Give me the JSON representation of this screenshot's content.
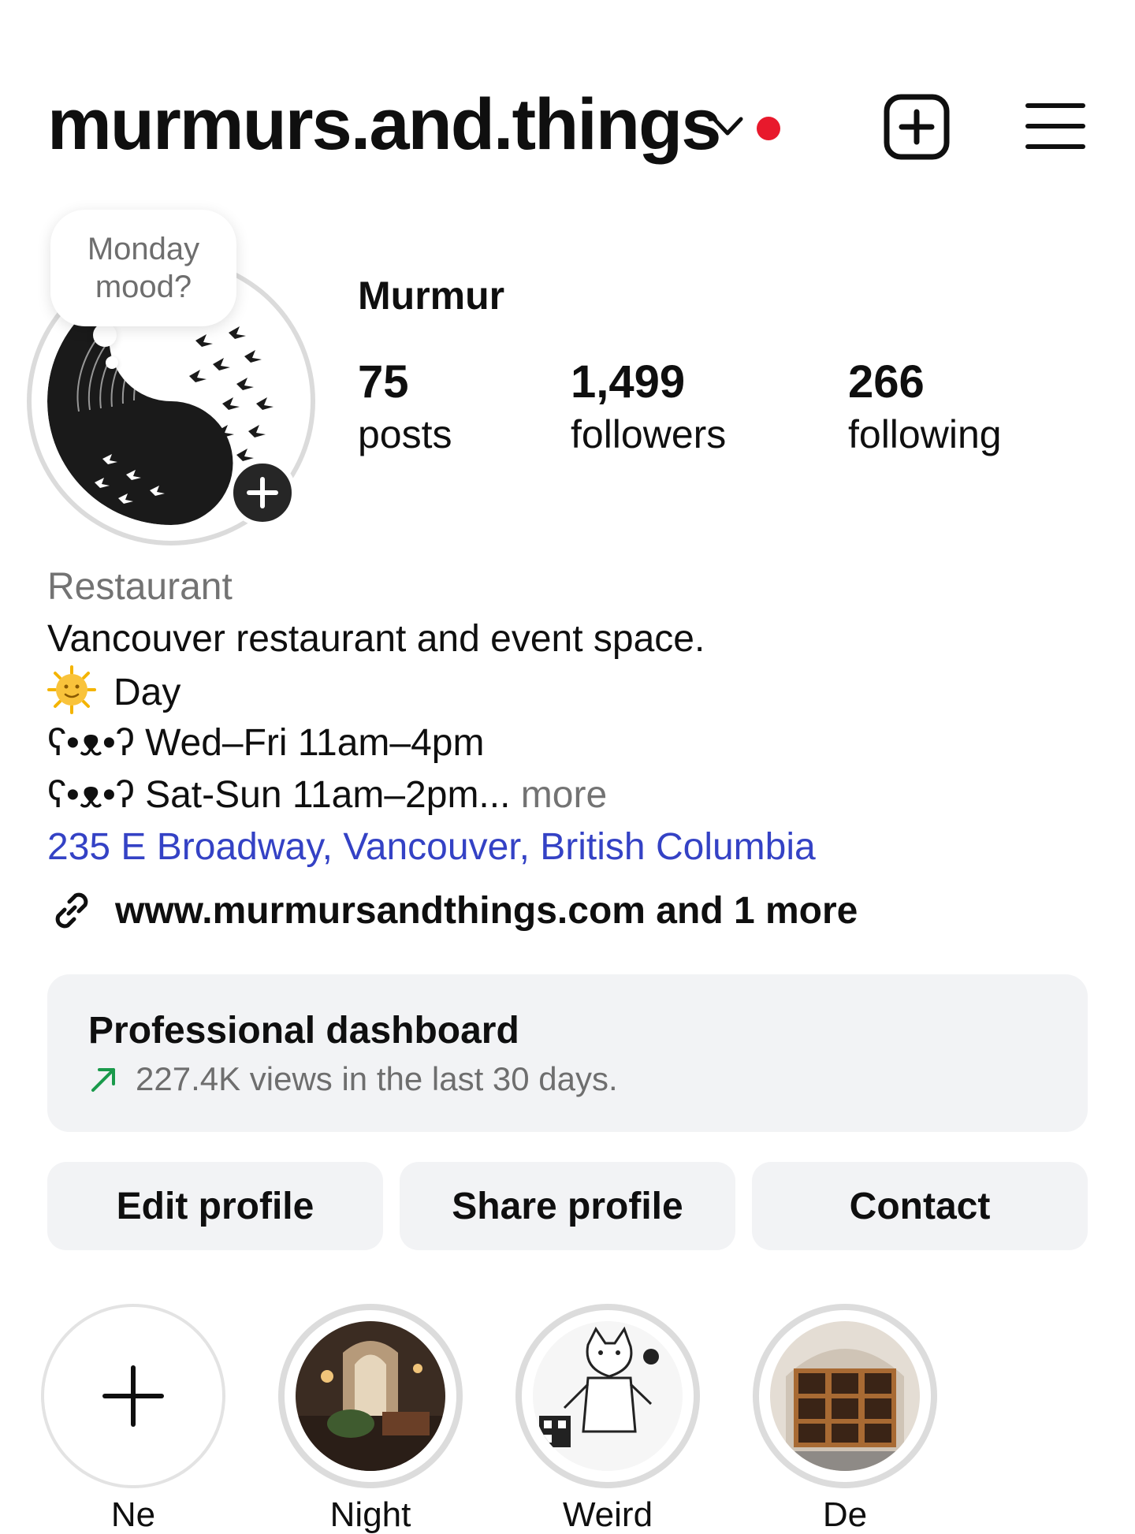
{
  "header": {
    "username": "murmurs.and.things",
    "notification_dot_color": "#e8192c",
    "new_post_icon": "plus-square-icon",
    "menu_icon": "hamburger-menu-icon",
    "dropdown_icon": "chevron-down-icon"
  },
  "profile": {
    "note": "Monday mood?",
    "display_name": "Murmur",
    "avatar": "yin-yang-birds-avatar",
    "stats": [
      {
        "value": "75",
        "label": "posts"
      },
      {
        "value": "1,499",
        "label": "followers"
      },
      {
        "value": "266",
        "label": "following"
      }
    ]
  },
  "bio": {
    "category": "Restaurant",
    "line1": "Vancouver restaurant and event space.",
    "line2": "Day",
    "line3": "ʕ•ᴥ•ʔ Wed–Fri 11am–4pm",
    "line4_text": "ʕ•ᴥ•ʔ Sat-Sun 11am–2pm...",
    "line4_more": "more",
    "address": "235 E Broadway, Vancouver, British Columbia",
    "website": "www.murmursandthings.com and 1 more",
    "link_color": "#3442c5"
  },
  "dashboard": {
    "title": "Professional dashboard",
    "subtitle": "227.4K views in the last 30 days.",
    "trend_color": "#1a9a4b"
  },
  "actions": {
    "edit": "Edit profile",
    "share": "Share profile",
    "contact": "Contact"
  },
  "highlights": [
    {
      "label": "Ne",
      "icon": "plus-icon"
    },
    {
      "label": "Night",
      "image": "restaurant-interior"
    },
    {
      "label": "Weird",
      "image": "cat-illustration"
    },
    {
      "label": "De",
      "image": "shelf-display"
    }
  ]
}
